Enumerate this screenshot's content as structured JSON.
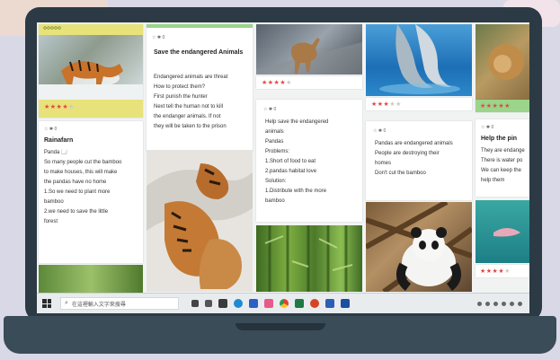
{
  "colors": {
    "accent_yellow": "#e8e27a",
    "accent_green": "#9bd48a",
    "star_red": "#e14a42",
    "laptop": "#2b3a45"
  },
  "column1": {
    "header_tag": "ΦΦΦΦΦ",
    "tiger_rating": 4,
    "note_pin": "☆ ✱ 0",
    "note_title": "Rainafarn",
    "note_body": [
      "Panda 🗔",
      "So many people cut the bamboo",
      "to make houses, this will make",
      "the pandas have no home",
      "1.So we need to plant more",
      "bamboo",
      "2.we need to save the little",
      "forest"
    ]
  },
  "column2": {
    "note_pin": "☆ ✱ 0",
    "note_title": "Save the endangered Animals",
    "note_body": [
      "Endangered animals are threat",
      "How to protect them?",
      "First punish the hunter",
      "Next tell the human not to kill",
      "the endanger animals. If not",
      "they will be taken to the prison"
    ]
  },
  "column3": {
    "rating": 4,
    "note_pin": "☆ ✱ 0",
    "note_body": [
      "Help save the endangered",
      "animals",
      "Pandas",
      "Problems:",
      "1.Short of food to eat",
      "2.pandas habitat love",
      "Solution:",
      "1.Distribute with the more",
      "bamboo"
    ]
  },
  "column4": {
    "rating": 3,
    "note_pin": "☆ ✱ 0",
    "note_body": [
      "Pandas are endangered animals",
      "People are destroying their",
      "homes",
      "Don't cut the bamboo"
    ]
  },
  "column5": {
    "rating": 5,
    "note_pin": "☆ ✱ 0",
    "note_title": "Help the pin",
    "note_body": [
      "They are endange",
      "There is water po",
      "We can keep the",
      "help them"
    ],
    "bottom_rating": 4
  },
  "taskbar": {
    "search_placeholder": "在這裡輸入文字來搜尋"
  }
}
